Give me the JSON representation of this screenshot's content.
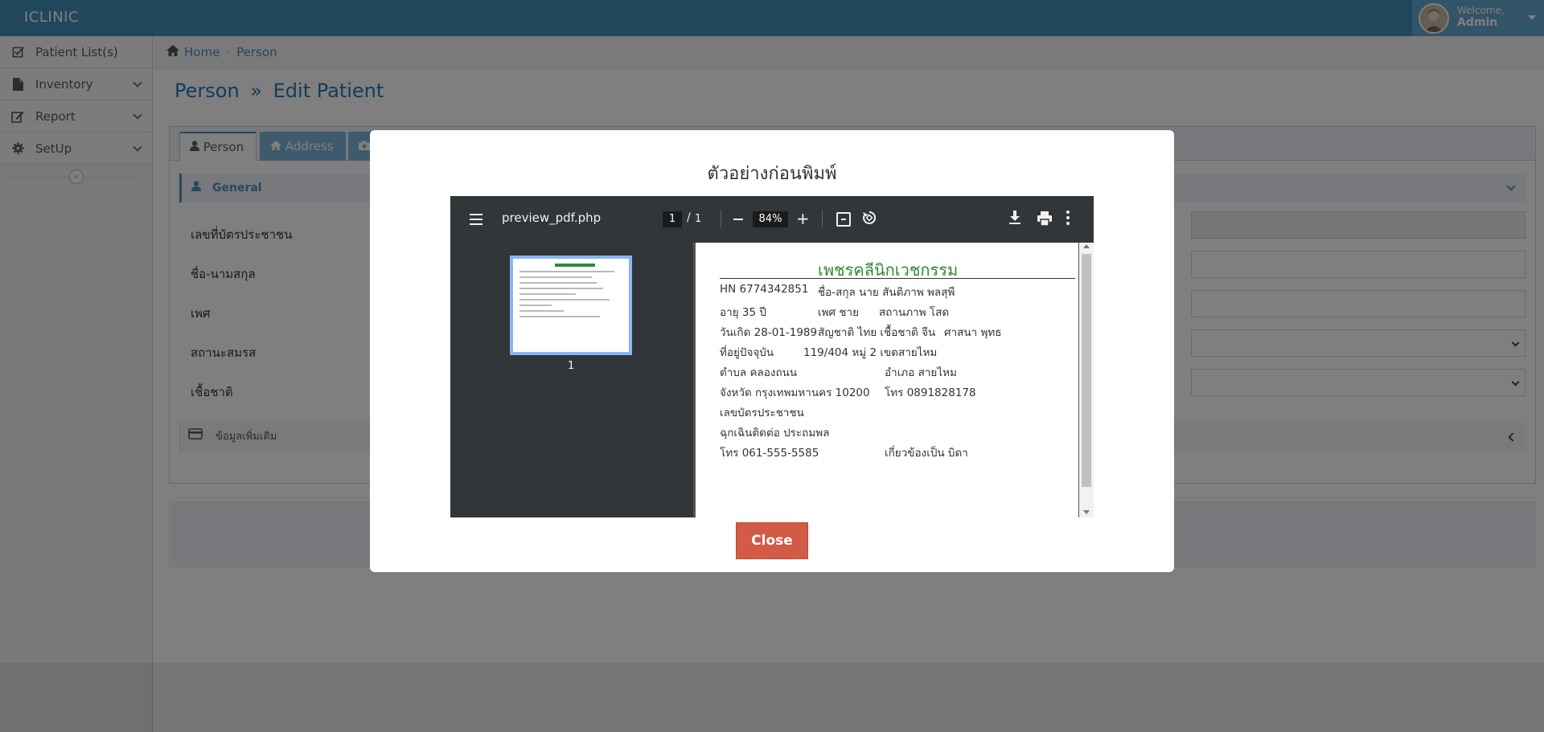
{
  "app": {
    "brand": "ICLINIC"
  },
  "user": {
    "welcome": "Welcome,",
    "name": "Admin"
  },
  "sidebar": {
    "items": [
      {
        "label": "Patient List(s)",
        "icon": "check-square-icon"
      },
      {
        "label": "Inventory",
        "icon": "file-icon"
      },
      {
        "label": "Report",
        "icon": "edit-icon"
      },
      {
        "label": "SetUp",
        "icon": "gear-icon"
      }
    ],
    "collapse_glyph": "«"
  },
  "breadcrumb": {
    "home": "Home",
    "current": "Person"
  },
  "page": {
    "title_a": "Person",
    "title_sep": "»",
    "title_b": "Edit Patient"
  },
  "tabs": [
    {
      "label": "Person"
    },
    {
      "label": "Address"
    }
  ],
  "form": {
    "section_general": "General",
    "fields": [
      "เลขที่บัตรประชาชน",
      "ชื่อ-นามสกุล",
      "เพศ",
      "สถานะสมรส",
      "เชื้อชาติ"
    ],
    "section_extra": "ข้อมูลเพิ่มเติม"
  },
  "modal": {
    "title": "ตัวอย่างก่อนพิมพ์",
    "close_label": "Close"
  },
  "viewer": {
    "file_name": "preview_pdf.php",
    "page_current": "1",
    "page_sep": "/",
    "page_total": "1",
    "zoom": "84%",
    "thumb_label": "1"
  },
  "pdf": {
    "title": "เพชรคลีนิกเวชกรรม",
    "hn": "HN 6774342851",
    "name": "ชื่อ-สกุล นาย สันติภาพ พลสุพี",
    "age": "อายุ 35 ปี",
    "sex": "เพศ ชาย",
    "marital": "สถานภาพ โสด",
    "birth": "วันเกิด 28-01-1989",
    "nationality": "สัญชาติ ไทย เชื้อชาติ จีน",
    "religion": "ศาสนา พุทธ",
    "address_label": "ที่อยู่ปัจจุบัน",
    "address": "119/404 หมู่ 2 เขตสายไหม",
    "subdistrict": "ตำบล คลองถนน",
    "district": "อำเภอ สายไหม",
    "province": "จังหวัด กรุงเทพมหานคร 10200",
    "phone": "โทร 0891828178",
    "id_label": "เลขบัตรประชาชน",
    "emergency": "ฉุกเฉินติดต่อ ประถมพล",
    "emergency_phone": "โทร 061-555-5585",
    "relation": "เกี่ยวข้องเป็น บิดา"
  }
}
